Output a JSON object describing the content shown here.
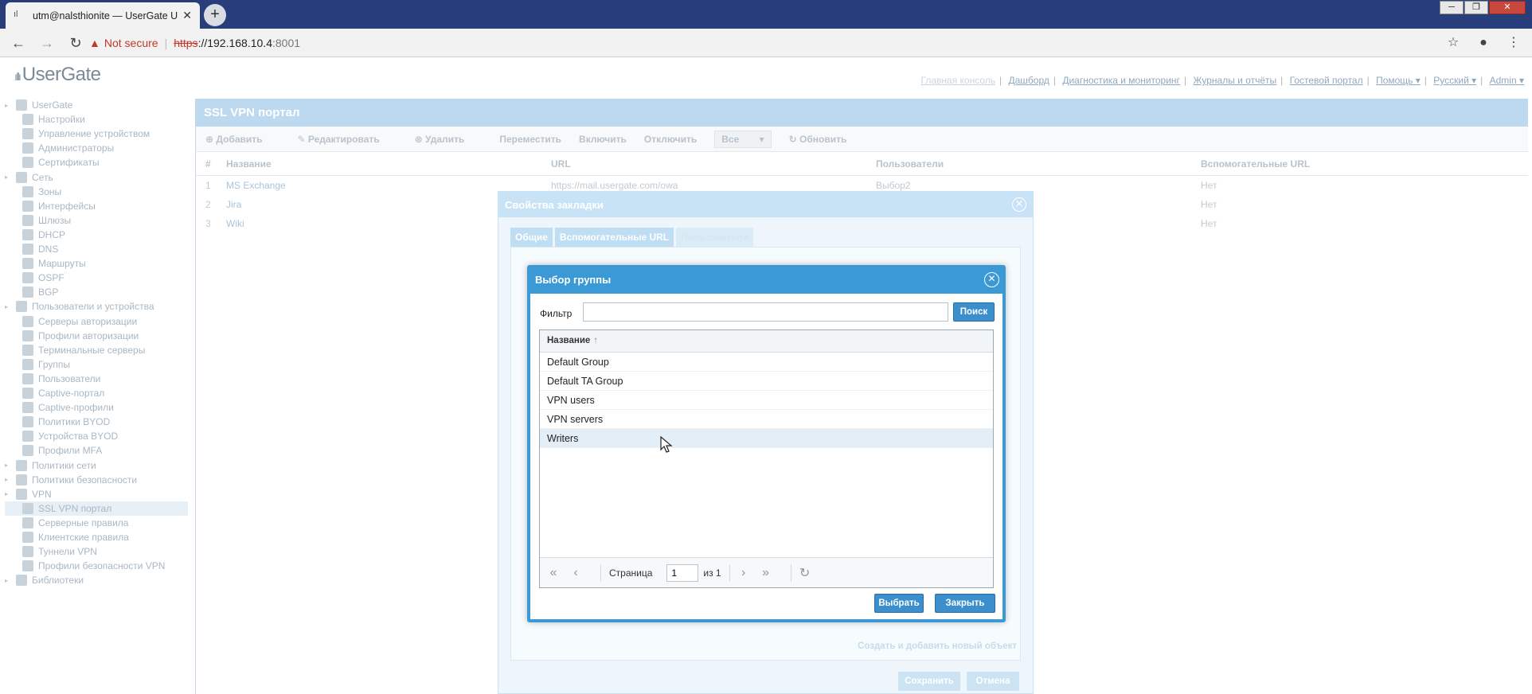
{
  "browser": {
    "tab_title": "utm@nalsthionite — UserGate U",
    "tab_close": "✕",
    "new_tab": "+",
    "not_secure": "Not secure",
    "url_scheme": "https",
    "url_host": "://192.168.10.4",
    "url_port": ":8001",
    "window_controls": [
      "─",
      "❐",
      "✕"
    ]
  },
  "app": {
    "logo": "UserGate",
    "topnav": {
      "items": [
        "Главная консоль",
        "Дашборд",
        "Диагностика и мониторинг",
        "Журналы и отчёты",
        "Гостевой портал",
        "Помощь ▾",
        "Русский ▾",
        "Admin ▾"
      ]
    }
  },
  "sidebar": {
    "items": [
      {
        "label": "UserGate",
        "level": 0,
        "icon": "globe-icon"
      },
      {
        "label": "Настройки",
        "level": 1,
        "icon": "gear-icon"
      },
      {
        "label": "Управление устройством",
        "level": 1,
        "icon": "device-icon"
      },
      {
        "label": "Администраторы",
        "level": 1,
        "icon": "admin-icon"
      },
      {
        "label": "Сертификаты",
        "level": 1,
        "icon": "certificate-icon"
      },
      {
        "label": "Сеть",
        "level": 0,
        "icon": "network-icon"
      },
      {
        "label": "Зоны",
        "level": 1,
        "icon": "zones-icon"
      },
      {
        "label": "Интерфейсы",
        "level": 1,
        "icon": "interfaces-icon"
      },
      {
        "label": "Шлюзы",
        "level": 1,
        "icon": "gateway-icon"
      },
      {
        "label": "DHCP",
        "level": 1,
        "icon": "dhcp-icon"
      },
      {
        "label": "DNS",
        "level": 1,
        "icon": "dns-icon"
      },
      {
        "label": "Маршруты",
        "level": 1,
        "icon": "routes-icon"
      },
      {
        "label": "OSPF",
        "level": 1,
        "icon": "ospf-icon"
      },
      {
        "label": "BGP",
        "level": 1,
        "icon": "bgp-icon"
      },
      {
        "label": "Пользователи и устройства",
        "level": 0,
        "icon": "users-devices-icon"
      },
      {
        "label": "Серверы авторизации",
        "level": 1,
        "icon": "auth-server-icon"
      },
      {
        "label": "Профили авторизации",
        "level": 1,
        "icon": "auth-profile-icon"
      },
      {
        "label": "Терминальные серверы",
        "level": 1,
        "icon": "terminal-server-icon"
      },
      {
        "label": "Группы",
        "level": 1,
        "icon": "groups-icon"
      },
      {
        "label": "Пользователи",
        "level": 1,
        "icon": "user-icon"
      },
      {
        "label": "Captive-портал",
        "level": 1,
        "icon": "captive-portal-icon"
      },
      {
        "label": "Captive-профили",
        "level": 1,
        "icon": "captive-profile-icon"
      },
      {
        "label": "Политики BYOD",
        "level": 1,
        "icon": "byod-policy-icon"
      },
      {
        "label": "Устройства BYOD",
        "level": 1,
        "icon": "byod-device-icon"
      },
      {
        "label": "Профили MFA",
        "level": 1,
        "icon": "mfa-icon"
      },
      {
        "label": "Политики сети",
        "level": 0,
        "icon": "network-policy-icon"
      },
      {
        "label": "Политики безопасности",
        "level": 0,
        "icon": "security-policy-icon"
      },
      {
        "label": "VPN",
        "level": 0,
        "icon": "vpn-icon"
      },
      {
        "label": "SSL VPN портал",
        "level": 1,
        "icon": "ssl-vpn-icon",
        "active": true
      },
      {
        "label": "Серверные правила",
        "level": 1,
        "icon": "server-rules-icon"
      },
      {
        "label": "Клиентские правила",
        "level": 1,
        "icon": "client-rules-icon"
      },
      {
        "label": "Туннели VPN",
        "level": 1,
        "icon": "vpn-tunnel-icon"
      },
      {
        "label": "Профили безопасности VPN",
        "level": 1,
        "icon": "vpn-security-icon"
      },
      {
        "label": "Библиотеки",
        "level": 0,
        "icon": "library-icon"
      }
    ]
  },
  "content": {
    "title": "SSL VPN портал",
    "toolbar": {
      "add": "Добавить",
      "edit": "Редактировать",
      "delete": "Удалить",
      "move": "Переместить",
      "enable": "Включить",
      "disable": "Отключить",
      "filter_value": "Все",
      "refresh": "Обновить"
    },
    "columns": [
      "#",
      "Название",
      "URL",
      "Пользователи",
      "Вспомогательные URL"
    ],
    "rows": [
      {
        "num": "1",
        "name": "MS Exchange",
        "url": "https://mail.usergate.com/owa",
        "users": "Выбор2",
        "aux": "Нет"
      },
      {
        "num": "2",
        "name": "Jira",
        "url": "",
        "users": "",
        "aux": "Нет"
      },
      {
        "num": "3",
        "name": "Wiki",
        "url": "",
        "users": "",
        "aux": "Нет"
      }
    ]
  },
  "bookmark_dialog": {
    "title": "Свойства закладки",
    "tabs": [
      "Общие",
      "Вспомогательные URL",
      "Пользователи"
    ],
    "create_link": "Создать и добавить новый объект",
    "save": "Сохранить",
    "cancel": "Отмена"
  },
  "group_dialog": {
    "title": "Выбор группы",
    "filter_label": "Фильтр",
    "filter_value": "",
    "search_button": "Поиск",
    "column_name": "Название",
    "sort_indicator": "↑",
    "groups": [
      "Default Group",
      "Default TA Group",
      "VPN users",
      "VPN servers",
      "Writers"
    ],
    "highlighted": "Writers",
    "pager": {
      "page_label": "Страница",
      "page_value": "1",
      "of_label": "из 1"
    },
    "select_button": "Выбрать",
    "close_button": "Закрыть"
  }
}
